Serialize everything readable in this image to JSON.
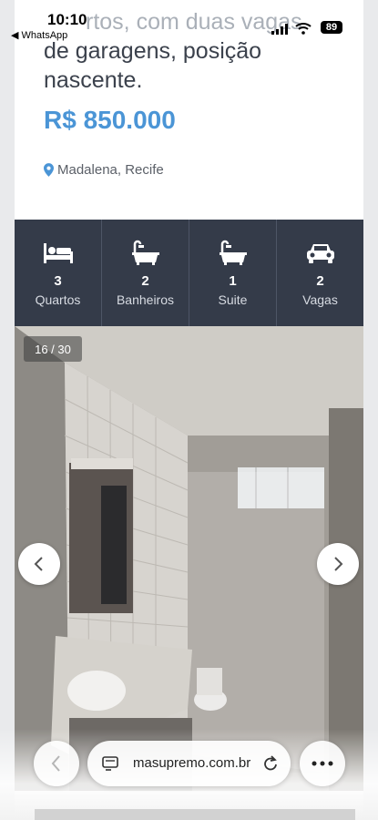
{
  "status_bar": {
    "time": "10:10",
    "back_app": "◀ WhatsApp",
    "battery": "89"
  },
  "listing": {
    "description_partial_top": "rtos, com duas vagas",
    "description_lines": [
      "de garagens, posição",
      "nascente."
    ],
    "price": "R$ 850.000",
    "location": "Madalena, Recife"
  },
  "features": [
    {
      "icon": "bed-icon",
      "value": "3",
      "label": "Quartos"
    },
    {
      "icon": "bathtub-icon",
      "value": "2",
      "label": "Banheiros"
    },
    {
      "icon": "bathtub-icon",
      "value": "1",
      "label": "Suite"
    },
    {
      "icon": "car-icon",
      "value": "2",
      "label": "Vagas"
    }
  ],
  "gallery": {
    "counter": "16 / 30"
  },
  "browser": {
    "url": "masupremo.com.br"
  },
  "colors": {
    "price": "#4b95d6",
    "features_bg": "#343b49"
  }
}
